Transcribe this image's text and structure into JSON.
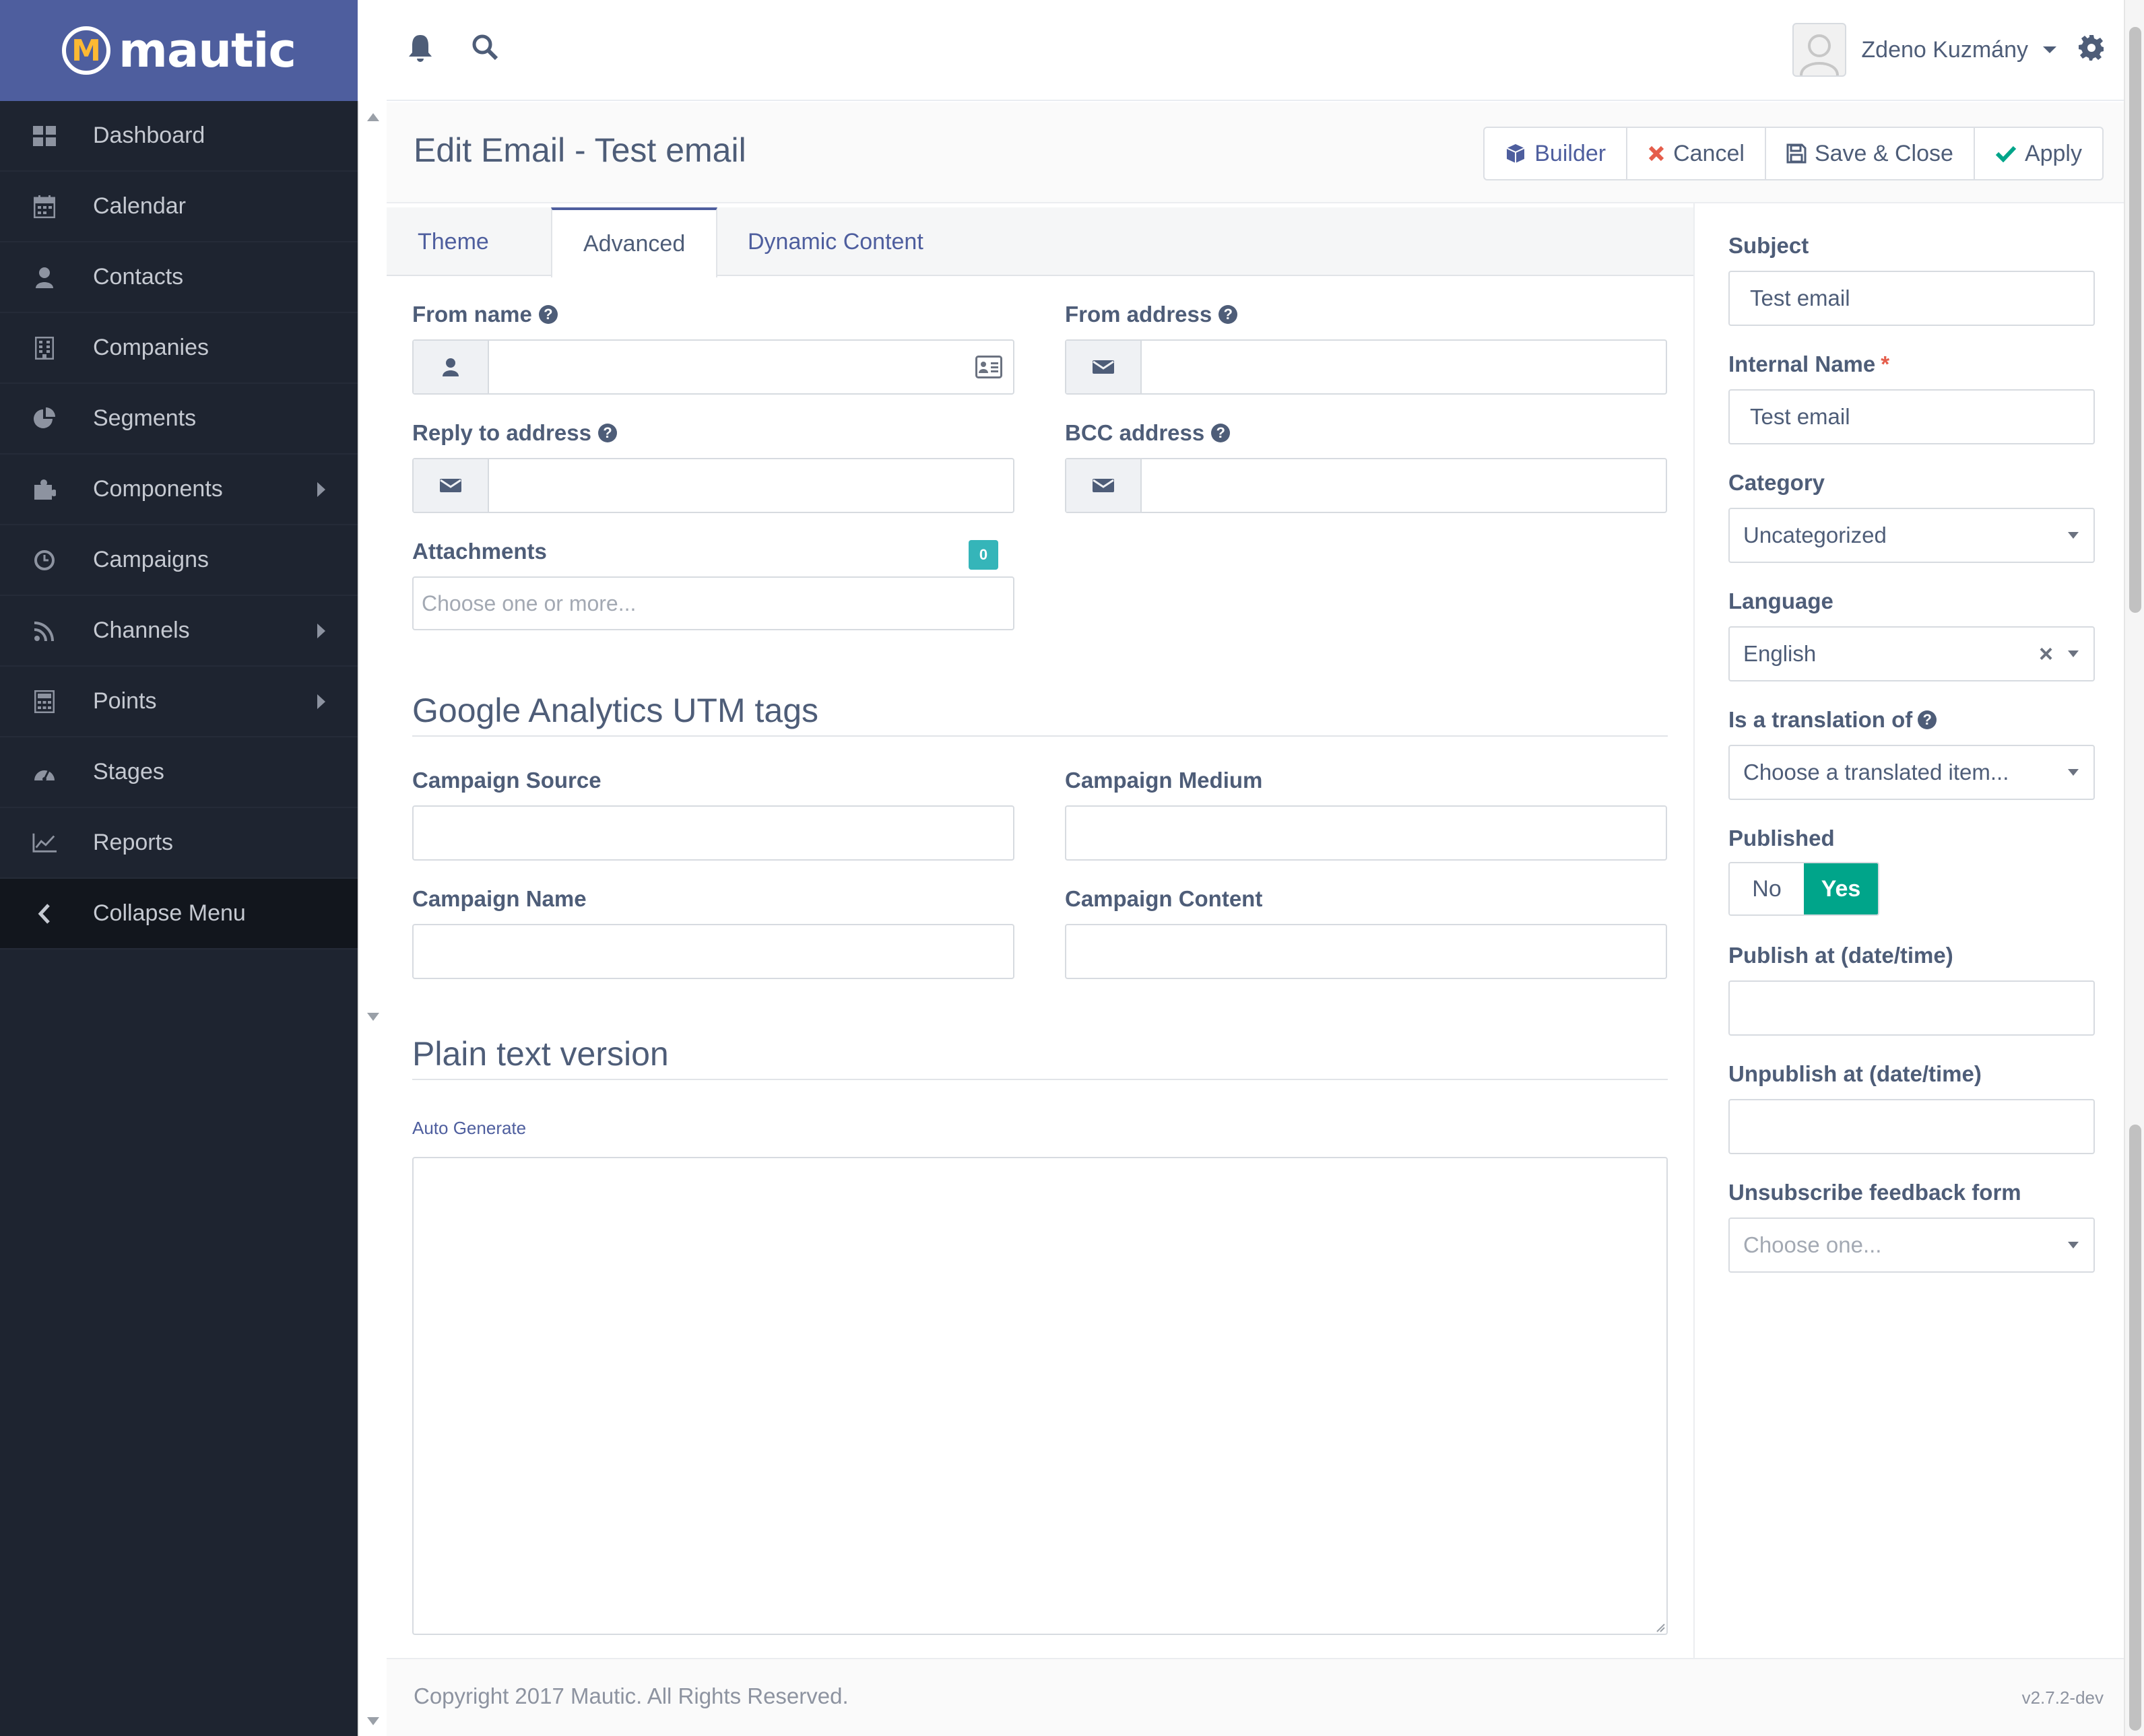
{
  "brand": {
    "name": "mautic"
  },
  "sidebar": {
    "items": [
      {
        "label": "Dashboard",
        "icon": "dashboard-icon",
        "has_submenu": false
      },
      {
        "label": "Calendar",
        "icon": "calendar-icon",
        "has_submenu": false
      },
      {
        "label": "Contacts",
        "icon": "user-icon",
        "has_submenu": false
      },
      {
        "label": "Companies",
        "icon": "building-icon",
        "has_submenu": false
      },
      {
        "label": "Segments",
        "icon": "pie-chart-icon",
        "has_submenu": false
      },
      {
        "label": "Components",
        "icon": "puzzle-icon",
        "has_submenu": true
      },
      {
        "label": "Campaigns",
        "icon": "clock-icon",
        "has_submenu": false
      },
      {
        "label": "Channels",
        "icon": "rss-icon",
        "has_submenu": true
      },
      {
        "label": "Points",
        "icon": "calculator-icon",
        "has_submenu": true
      },
      {
        "label": "Stages",
        "icon": "tachometer-icon",
        "has_submenu": false
      },
      {
        "label": "Reports",
        "icon": "line-chart-icon",
        "has_submenu": false
      }
    ],
    "collapse_label": "Collapse Menu"
  },
  "topbar": {
    "user_name": "Zdeno Kuzmány"
  },
  "header": {
    "title": "Edit Email - Test email",
    "buttons": {
      "builder": "Builder",
      "cancel": "Cancel",
      "save_close": "Save & Close",
      "apply": "Apply"
    }
  },
  "tabs": {
    "theme": "Theme",
    "advanced": "Advanced",
    "dynamic_content": "Dynamic Content"
  },
  "form": {
    "from_name_label": "From name",
    "from_address_label": "From address",
    "reply_to_label": "Reply to address",
    "bcc_label": "BCC address",
    "attachments_label": "Attachments",
    "attachments_count": "0",
    "attachments_placeholder": "Choose one or more...",
    "utm_title": "Google Analytics UTM tags",
    "campaign_source_label": "Campaign Source",
    "campaign_medium_label": "Campaign Medium",
    "campaign_name_label": "Campaign Name",
    "campaign_content_label": "Campaign Content",
    "plain_text_title": "Plain text version",
    "auto_generate": "Auto Generate"
  },
  "rpanel": {
    "subject_label": "Subject",
    "subject_value": "Test email",
    "internal_name_label": "Internal Name",
    "internal_name_required": "*",
    "internal_name_value": "Test email",
    "category_label": "Category",
    "category_value": "Uncategorized",
    "language_label": "Language",
    "language_value": "English",
    "translation_label": "Is a translation of",
    "translation_placeholder": "Choose a translated item...",
    "published_label": "Published",
    "published_no": "No",
    "published_yes": "Yes",
    "publish_at_label": "Publish at (date/time)",
    "unpublish_at_label": "Unpublish at (date/time)",
    "unsubscribe_label": "Unsubscribe feedback form",
    "unsubscribe_placeholder": "Choose one..."
  },
  "footer": {
    "copyright": "Copyright 2017 Mautic. All Rights Reserved.",
    "version": "v2.7.2-dev"
  },
  "colors": {
    "brand_bar": "#4e5e9e",
    "sidebar_bg": "#1e2430",
    "accent_yes": "#00a58a",
    "badge": "#35b5b9",
    "cancel_red": "#e55d4b",
    "apply_green": "#00a58a"
  }
}
